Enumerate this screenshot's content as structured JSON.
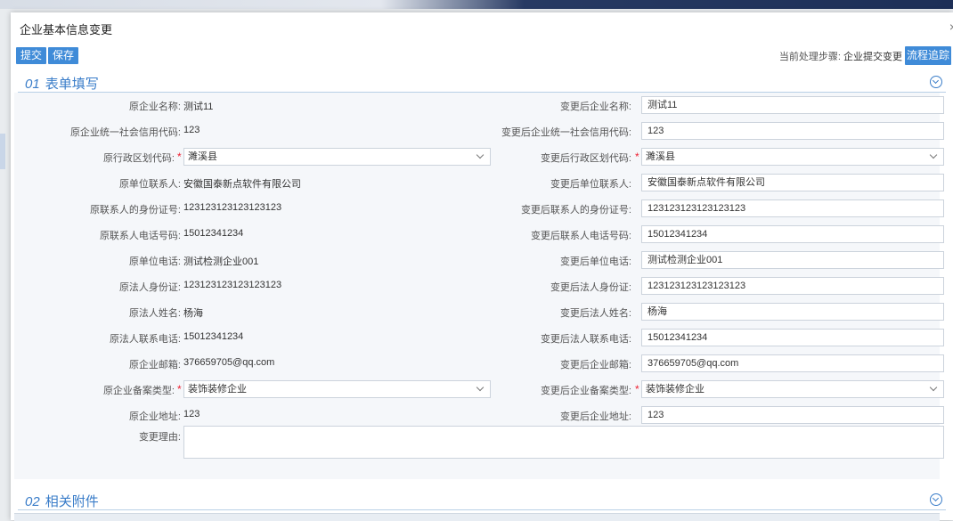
{
  "dialog": {
    "title": "企业基本信息变更",
    "close": "×",
    "toolbar": {
      "submit": "提交",
      "save": "保存"
    },
    "step_prefix": "当前处理步骤:",
    "step_value": "企业提交变更",
    "trace_button": "流程追踪"
  },
  "section1": {
    "num": "01",
    "title": "表单填写"
  },
  "section2": {
    "num": "02",
    "title": "相关附件"
  },
  "rows": [
    {
      "left_label": "原企业名称:",
      "left_value": "测试11",
      "right_label": "变更后企业名称:",
      "right_value": "测试11",
      "type": "text"
    },
    {
      "left_label": "原企业统一社会信用代码:",
      "left_value": "123",
      "right_label": "变更后企业统一社会信用代码:",
      "right_value": "123",
      "type": "text"
    },
    {
      "left_label": "原行政区划代码:",
      "left_value": "濉溪县",
      "right_label": "变更后行政区划代码:",
      "right_value": "濉溪县",
      "type": "select"
    },
    {
      "left_label": "原单位联系人:",
      "left_value": "安徽国泰新点软件有限公司",
      "right_label": "变更后单位联系人:",
      "right_value": "安徽国泰新点软件有限公司",
      "type": "text"
    },
    {
      "left_label": "原联系人的身份证号:",
      "left_value": "123123123123123123",
      "right_label": "变更后联系人的身份证号:",
      "right_value": "123123123123123123",
      "type": "text"
    },
    {
      "left_label": "原联系人电话号码:",
      "left_value": "15012341234",
      "right_label": "变更后联系人电话号码:",
      "right_value": "15012341234",
      "type": "text"
    },
    {
      "left_label": "原单位电话:",
      "left_value": "测试检测企业001",
      "right_label": "变更后单位电话:",
      "right_value": "测试检测企业001",
      "type": "text"
    },
    {
      "left_label": "原法人身份证:",
      "left_value": "123123123123123123",
      "right_label": "变更后法人身份证:",
      "right_value": "123123123123123123",
      "type": "text"
    },
    {
      "left_label": "原法人姓名:",
      "left_value": "杨海",
      "right_label": "变更后法人姓名:",
      "right_value": "杨海",
      "type": "text"
    },
    {
      "left_label": "原法人联系电话:",
      "left_value": "15012341234",
      "right_label": "变更后法人联系电话:",
      "right_value": "15012341234",
      "type": "text"
    },
    {
      "left_label": "原企业邮箱:",
      "left_value": "376659705@qq.com",
      "right_label": "变更后企业邮箱:",
      "right_value": "376659705@qq.com",
      "type": "text"
    },
    {
      "left_label": "原企业备案类型:",
      "left_value": "装饰装修企业",
      "right_label": "变更后企业备案类型:",
      "right_value": "装饰装修企业",
      "type": "select"
    },
    {
      "left_label": "原企业地址:",
      "left_value": "123",
      "right_label": "变更后企业地址:",
      "right_value": "123",
      "type": "text"
    }
  ],
  "reason": {
    "label": "变更理由:",
    "value": ""
  },
  "required_mark": "*",
  "colors": {
    "accent": "#3f8bd8",
    "required": "#e23333",
    "panel": "#f5f7fa"
  }
}
